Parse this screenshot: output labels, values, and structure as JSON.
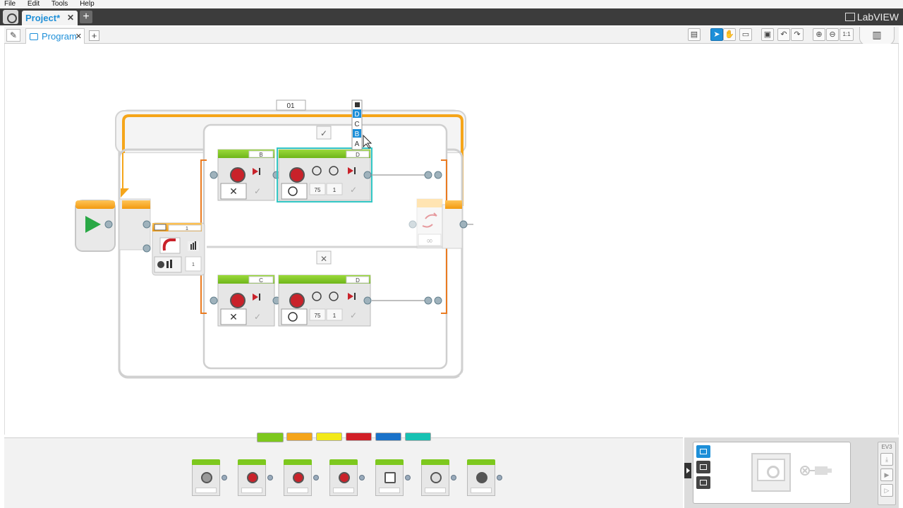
{
  "menu": {
    "file": "File",
    "edit": "Edit",
    "tools": "Tools",
    "help": "Help"
  },
  "project_tab": {
    "label": "Project*",
    "close": "✕",
    "add": "+"
  },
  "brand": {
    "name": "LabVIEW"
  },
  "program_tab": {
    "label": "Program",
    "close": "✕",
    "add": "+"
  },
  "toolbar": {
    "zoom_reset": "1:1"
  },
  "canvas": {
    "loop_label": "01",
    "switch_true": "✓",
    "switch_false": "✕",
    "sensor_block": {
      "port": "1",
      "value": "1"
    },
    "top_case": {
      "block1": {
        "port": "B"
      },
      "block2": {
        "port": "D",
        "power": "75",
        "rotations": "1"
      }
    },
    "bottom_case": {
      "block1": {
        "port": "C"
      },
      "block2": {
        "port": "D",
        "power": "75",
        "rotations": "1"
      }
    },
    "port_dropdown": {
      "options": [
        "D",
        "C",
        "B",
        "A"
      ],
      "selected": [
        "D",
        "B"
      ]
    }
  },
  "palette": {
    "tabs": [
      {
        "color": "#7dc81e",
        "active": true
      },
      {
        "color": "#f5a51a",
        "active": false
      },
      {
        "color": "#f3e918",
        "active": false
      },
      {
        "color": "#d21f27",
        "active": false
      },
      {
        "color": "#1a72c9",
        "active": false
      },
      {
        "color": "#17c2b3",
        "active": false
      }
    ],
    "blocks": [
      {
        "icon": "medium-motor-icon"
      },
      {
        "icon": "large-motor-icon"
      },
      {
        "icon": "move-steering-icon"
      },
      {
        "icon": "move-tank-icon"
      },
      {
        "icon": "display-icon"
      },
      {
        "icon": "sound-icon"
      },
      {
        "icon": "brick-status-light-icon"
      }
    ]
  },
  "hardware": {
    "ev3_label": "EV3"
  },
  "colors": {
    "action_green": "#7dc81e",
    "flow_orange": "#f5a51a",
    "accent_blue": "#1d8fd8",
    "selection_teal": "#33c7c5",
    "motor_red": "#c9222a"
  }
}
